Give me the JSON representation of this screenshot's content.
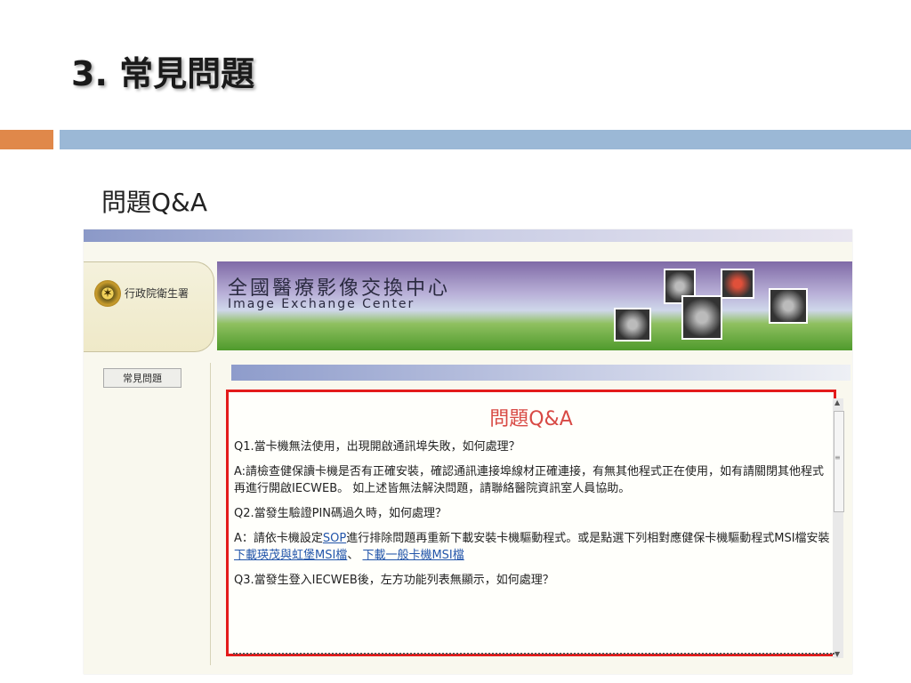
{
  "slide": {
    "title": "3. 常見問題",
    "subtitle": "問題Q&A"
  },
  "site": {
    "agency": "行政院衛生署",
    "banner_cn": "全國醫療影像交換中心",
    "banner_en": "Image Exchange Center"
  },
  "sidebar": {
    "faq_button": "常見問題"
  },
  "qa": {
    "heading": "問題Q&A",
    "q1": "Q1.當卡機無法使用，出現開啟通訊埠失敗，如何處理？",
    "a1": "A:請檢查健保讀卡機是否有正確安裝，確認通訊連接埠線材正確連接，有無其他程式正在使用，如有請關閉其他程式再進行開啟IECWEB。 如上述皆無法解決問題，請聯絡醫院資訊室人員協助。",
    "q2": "Q2.當發生驗證PIN碼過久時，如何處理？",
    "a2_prefix": "A：請依卡機設定",
    "a2_link": "SOP",
    "a2_suffix": "進行排除問題再重新下載安裝卡機驅動程式。或是點選下列相對應健保卡機驅動程式MSI檔安裝",
    "link_a": "下載瑛茂與虹堡MSI檔",
    "link_separator": "、",
    "link_b": "下載一般卡機MSI檔",
    "q3": "Q3.當發生登入IECWEB後，左方功能列表無顯示，如何處理？"
  },
  "colors": {
    "accent_orange": "#e0884a",
    "accent_blue": "#9bb8d6",
    "highlight_red": "#e31b1b",
    "heading_red": "#d84a45",
    "link_blue": "#2255aa"
  }
}
